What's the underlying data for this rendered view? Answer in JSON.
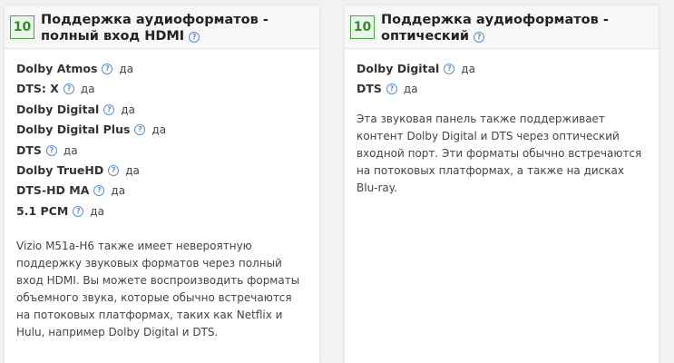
{
  "help_glyph": "?",
  "left_card": {
    "score": "10",
    "title": "Поддержка аудиоформатов - полный вход HDMI",
    "rows": [
      {
        "label": "Dolby Atmos",
        "value": "да"
      },
      {
        "label": "DTS: X",
        "value": "да"
      },
      {
        "label": "Dolby Digital",
        "value": "да"
      },
      {
        "label": "Dolby Digital Plus",
        "value": "да"
      },
      {
        "label": "DTS",
        "value": "да"
      },
      {
        "label": "Dolby TrueHD",
        "value": "да"
      },
      {
        "label": "DTS-HD MA",
        "value": "да"
      },
      {
        "label": "5.1 PCM",
        "value": "да"
      }
    ],
    "description": "Vizio M51a-H6 также имеет невероятную поддержку звуковых форматов через полный вход HDMI. Вы можете воспроизводить форматы объемного звука, которые обычно встречаются на потоковых платформах, таких как Netflix и Hulu, например Dolby Digital и DTS."
  },
  "right_card": {
    "score": "10",
    "title": "Поддержка аудиоформатов - оптический",
    "rows": [
      {
        "label": "Dolby Digital",
        "value": "да"
      },
      {
        "label": "DTS",
        "value": "да"
      }
    ],
    "description": "Эта звуковая панель также поддерживает контент Dolby Digital и DTS через оптический входной порт. Эти форматы обычно встречаются на потоковых платформах, а также на дисках Blu-ray."
  }
}
